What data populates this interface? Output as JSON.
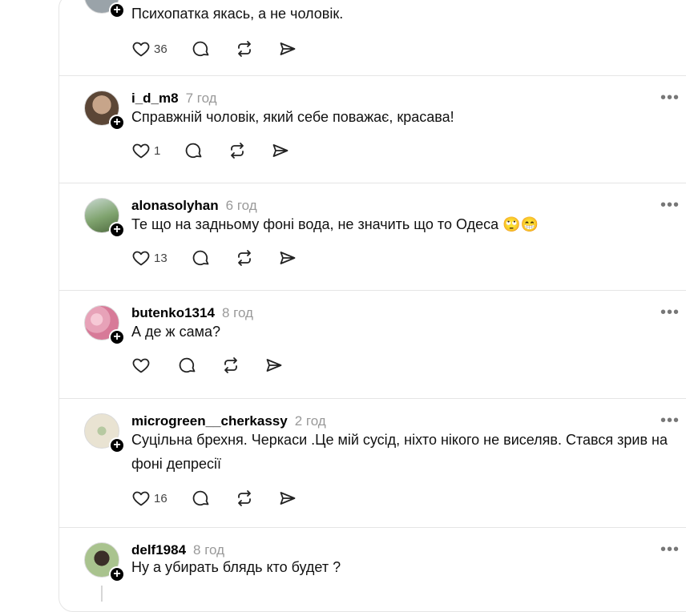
{
  "posts": [
    {
      "username": "",
      "time": "",
      "text": "Психопатка якась, а не чоловік.",
      "likes": "36",
      "avatar_color": "#9aa3a9"
    },
    {
      "username": "i_d_m8",
      "time": "7 год",
      "text": "Справжній чоловік, який себе поважає, красава!",
      "likes": "1",
      "avatar_color": "#8b6a4f"
    },
    {
      "username": "alonasolyhan",
      "time": "6 год",
      "text": "Те що на задньому фоні вода, не значить що то Одеса 🙄😁",
      "likes": "13",
      "avatar_color": "#7fa36e"
    },
    {
      "username": "butenko1314",
      "time": "8 год",
      "text": "А де ж сама?",
      "likes": "",
      "avatar_color": "#e7a2b8"
    },
    {
      "username": "microgreen__cherkassy",
      "time": "2 год",
      "text": "Суцільна брехня. Черкаси .Це мій сусід, ніхто нікого не виселяв. Стався зрив на фоні депресії",
      "likes": "16",
      "avatar_color": "#e9e3d2"
    },
    {
      "username": "delf1984",
      "time": "8 год",
      "text": "Ну а убирать блядь кто будет ?",
      "likes": "",
      "avatar_color": "#6f8f5a"
    }
  ],
  "icons": {
    "like": "heart-icon",
    "comment": "comment-icon",
    "repost": "repost-icon",
    "share": "send-icon",
    "more": "more-icon",
    "follow": "plus-icon"
  },
  "more_label": "•••",
  "follow_label": "+"
}
